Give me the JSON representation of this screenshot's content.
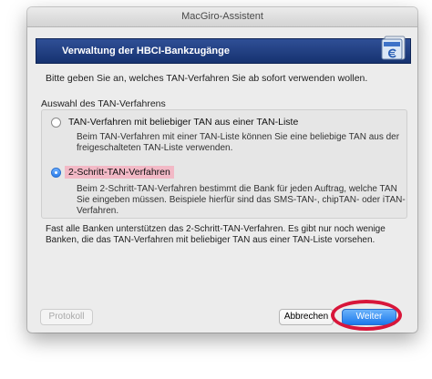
{
  "window": {
    "title": "MacGiro-Assistent"
  },
  "header": {
    "title": "Verwaltung der HBCI-Bankzugänge"
  },
  "intro_text": "Bitte geben Sie an, welches TAN-Verfahren Sie ab sofort verwenden wollen.",
  "group": {
    "label": "Auswahl des TAN-Verfahrens",
    "options": [
      {
        "label": "TAN-Verfahren mit beliebiger TAN aus einer TAN-Liste",
        "selected": false,
        "description": [
          "Beim TAN-Verfahren mit einer TAN-Liste können Sie eine beliebige TAN aus der",
          "freigeschalteten TAN-Liste verwenden."
        ]
      },
      {
        "label": "2-Schritt-TAN-Verfahren",
        "selected": true,
        "description": [
          "Beim 2-Schritt-TAN-Verfahren bestimmt die Bank für jeden Auftrag, welche TAN",
          "Sie eingeben müssen. Beispiele hierfür sind das SMS-TAN-, chipTAN- oder iTAN-",
          "Verfahren."
        ]
      }
    ]
  },
  "note": [
    "Fast alle Banken unterstützen das 2-Schritt-TAN-Verfahren. Es gibt nur noch wenige",
    "Banken, die das TAN-Verfahren mit beliebiger TAN aus einer TAN-Liste vorsehen."
  ],
  "buttons": {
    "protokoll": "Protokoll",
    "abbrechen": "Abbrechen",
    "weiter": "Weiter"
  },
  "colors": {
    "header_bg": "#1f3c80",
    "selection_highlight": "#f2b9c6",
    "default_button": "#1b79ec",
    "annotation_ring": "#d8163a"
  }
}
